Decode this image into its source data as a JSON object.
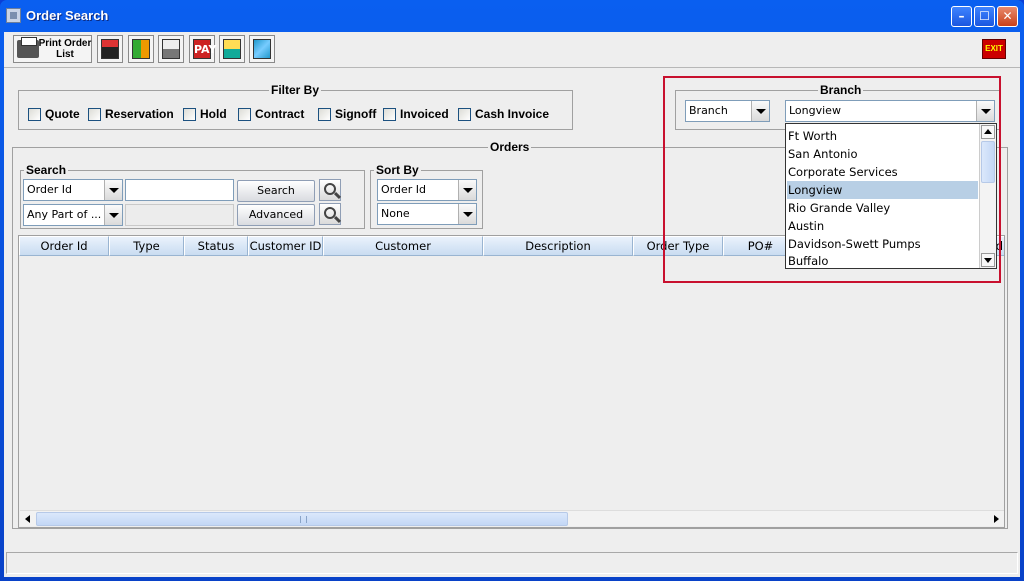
{
  "window": {
    "title": "Order Search",
    "controls": {
      "minimize": "–",
      "maximize": "☐",
      "close": "✕"
    }
  },
  "toolbar": {
    "print_label": "Print Order List",
    "pay_label": "PAY",
    "exit_label": "EXIT"
  },
  "filter": {
    "title": "Filter By",
    "options": [
      {
        "label": "Quote",
        "checked": false
      },
      {
        "label": "Reservation",
        "checked": false
      },
      {
        "label": "Hold",
        "checked": false
      },
      {
        "label": "Contract",
        "checked": false
      },
      {
        "label": "Signoff",
        "checked": false
      },
      {
        "label": "Invoiced",
        "checked": false
      },
      {
        "label": "Cash Invoice",
        "checked": false
      }
    ]
  },
  "branch": {
    "title": "Branch",
    "mode_value": "Branch",
    "selected": "Longview",
    "options": [
      "Ft Worth",
      "San Antonio",
      "Corporate Services",
      "Longview",
      "Rio Grande Valley",
      "Austin",
      "Davidson-Swett Pumps",
      "Buffalo"
    ],
    "selected_index": 3
  },
  "orders": {
    "title": "Orders"
  },
  "search": {
    "title": "Search",
    "field_value": "Order Id",
    "match_value": "Any Part of ...",
    "query": "",
    "search_label": "Search",
    "advanced_label": "Advanced"
  },
  "sort": {
    "title": "Sort By",
    "primary": "Order Id",
    "secondary": "None"
  },
  "table": {
    "columns": [
      "Order Id",
      "Type",
      "Status",
      "Customer ID",
      "Customer",
      "Description",
      "Order Type",
      "PO#",
      "d"
    ],
    "rows": []
  },
  "colors": {
    "title_bar": "#0a5ff0",
    "highlight": "#c8102e",
    "selected_option": "#b8cfe5",
    "header": "#c9dcf1"
  }
}
